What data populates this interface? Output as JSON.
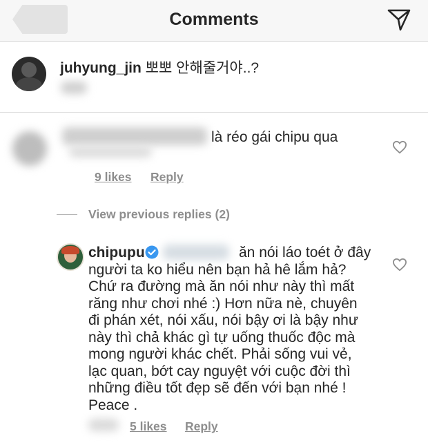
{
  "header": {
    "title": "Comments"
  },
  "caption": {
    "username": "juhyung_jin",
    "text": "뽀뽀 안해줄거야..?"
  },
  "comment1": {
    "text": "là réo gái chipu qua",
    "likes": "9 likes",
    "reply": "Reply"
  },
  "view_previous": "View previous replies (2)",
  "reply": {
    "username": "chipupu",
    "lines": [
      "ăn nói láo toét ở đây",
      "người ta ko hiểu nên bạn hả hê lắm hả?",
      "Chứ ra đường mà ăn nói như này thì mất",
      "răng như chơi nhé :) Hơn nữa nè, chuyên",
      "đi  phán xét, nói xấu, nói bậy ơi là bậy như",
      "này thì chả khác gì tự uống thuốc độc mà",
      "mong người khác chết. Phải sống vui vẻ,",
      "lạc quan, bớt cay nguyệt với cuộc đời thì",
      "những điều tốt đẹp sẽ đến với bạn nhé !",
      "Peace ."
    ],
    "likes": "5 likes",
    "reply_label": "Reply"
  },
  "colors": {
    "verified": "#3897f0",
    "secondary_text": "#8e8e8e",
    "header_bg": "#f7f7f7"
  }
}
